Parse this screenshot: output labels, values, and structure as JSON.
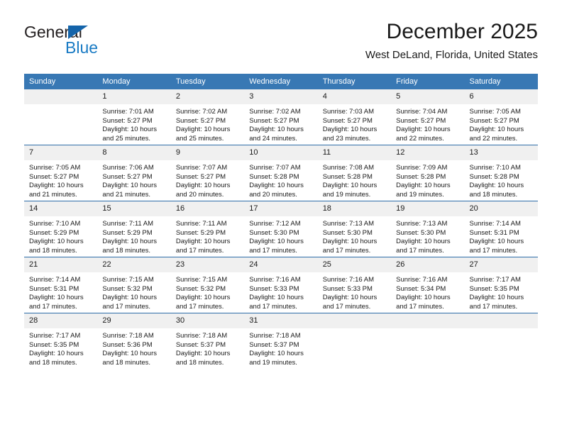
{
  "brand": {
    "name_top": "General",
    "name_bottom": "Blue",
    "accent_color": "#1464aa"
  },
  "header": {
    "title": "December 2025",
    "subtitle": "West DeLand, Florida, United States"
  },
  "theme": {
    "header_row_bg": "#3878b4",
    "daynum_bg": "#f0f0f0",
    "grid_line": "#2d6ca8",
    "text": "#1a1a1a"
  },
  "weekday_headers": [
    "Sunday",
    "Monday",
    "Tuesday",
    "Wednesday",
    "Thursday",
    "Friday",
    "Saturday"
  ],
  "labels": {
    "sunrise_prefix": "Sunrise:",
    "sunset_prefix": "Sunset:",
    "daylight_prefix": "Daylight:"
  },
  "weeks": [
    [
      {
        "day": "",
        "sunrise": "",
        "sunset": "",
        "daylight": "",
        "blank": true
      },
      {
        "day": "1",
        "sunrise": "Sunrise: 7:01 AM",
        "sunset": "Sunset: 5:27 PM",
        "daylight": "Daylight: 10 hours and 25 minutes."
      },
      {
        "day": "2",
        "sunrise": "Sunrise: 7:02 AM",
        "sunset": "Sunset: 5:27 PM",
        "daylight": "Daylight: 10 hours and 25 minutes."
      },
      {
        "day": "3",
        "sunrise": "Sunrise: 7:02 AM",
        "sunset": "Sunset: 5:27 PM",
        "daylight": "Daylight: 10 hours and 24 minutes."
      },
      {
        "day": "4",
        "sunrise": "Sunrise: 7:03 AM",
        "sunset": "Sunset: 5:27 PM",
        "daylight": "Daylight: 10 hours and 23 minutes."
      },
      {
        "day": "5",
        "sunrise": "Sunrise: 7:04 AM",
        "sunset": "Sunset: 5:27 PM",
        "daylight": "Daylight: 10 hours and 22 minutes."
      },
      {
        "day": "6",
        "sunrise": "Sunrise: 7:05 AM",
        "sunset": "Sunset: 5:27 PM",
        "daylight": "Daylight: 10 hours and 22 minutes."
      }
    ],
    [
      {
        "day": "7",
        "sunrise": "Sunrise: 7:05 AM",
        "sunset": "Sunset: 5:27 PM",
        "daylight": "Daylight: 10 hours and 21 minutes."
      },
      {
        "day": "8",
        "sunrise": "Sunrise: 7:06 AM",
        "sunset": "Sunset: 5:27 PM",
        "daylight": "Daylight: 10 hours and 21 minutes."
      },
      {
        "day": "9",
        "sunrise": "Sunrise: 7:07 AM",
        "sunset": "Sunset: 5:27 PM",
        "daylight": "Daylight: 10 hours and 20 minutes."
      },
      {
        "day": "10",
        "sunrise": "Sunrise: 7:07 AM",
        "sunset": "Sunset: 5:28 PM",
        "daylight": "Daylight: 10 hours and 20 minutes."
      },
      {
        "day": "11",
        "sunrise": "Sunrise: 7:08 AM",
        "sunset": "Sunset: 5:28 PM",
        "daylight": "Daylight: 10 hours and 19 minutes."
      },
      {
        "day": "12",
        "sunrise": "Sunrise: 7:09 AM",
        "sunset": "Sunset: 5:28 PM",
        "daylight": "Daylight: 10 hours and 19 minutes."
      },
      {
        "day": "13",
        "sunrise": "Sunrise: 7:10 AM",
        "sunset": "Sunset: 5:28 PM",
        "daylight": "Daylight: 10 hours and 18 minutes."
      }
    ],
    [
      {
        "day": "14",
        "sunrise": "Sunrise: 7:10 AM",
        "sunset": "Sunset: 5:29 PM",
        "daylight": "Daylight: 10 hours and 18 minutes."
      },
      {
        "day": "15",
        "sunrise": "Sunrise: 7:11 AM",
        "sunset": "Sunset: 5:29 PM",
        "daylight": "Daylight: 10 hours and 18 minutes."
      },
      {
        "day": "16",
        "sunrise": "Sunrise: 7:11 AM",
        "sunset": "Sunset: 5:29 PM",
        "daylight": "Daylight: 10 hours and 17 minutes."
      },
      {
        "day": "17",
        "sunrise": "Sunrise: 7:12 AM",
        "sunset": "Sunset: 5:30 PM",
        "daylight": "Daylight: 10 hours and 17 minutes."
      },
      {
        "day": "18",
        "sunrise": "Sunrise: 7:13 AM",
        "sunset": "Sunset: 5:30 PM",
        "daylight": "Daylight: 10 hours and 17 minutes."
      },
      {
        "day": "19",
        "sunrise": "Sunrise: 7:13 AM",
        "sunset": "Sunset: 5:30 PM",
        "daylight": "Daylight: 10 hours and 17 minutes."
      },
      {
        "day": "20",
        "sunrise": "Sunrise: 7:14 AM",
        "sunset": "Sunset: 5:31 PM",
        "daylight": "Daylight: 10 hours and 17 minutes."
      }
    ],
    [
      {
        "day": "21",
        "sunrise": "Sunrise: 7:14 AM",
        "sunset": "Sunset: 5:31 PM",
        "daylight": "Daylight: 10 hours and 17 minutes."
      },
      {
        "day": "22",
        "sunrise": "Sunrise: 7:15 AM",
        "sunset": "Sunset: 5:32 PM",
        "daylight": "Daylight: 10 hours and 17 minutes."
      },
      {
        "day": "23",
        "sunrise": "Sunrise: 7:15 AM",
        "sunset": "Sunset: 5:32 PM",
        "daylight": "Daylight: 10 hours and 17 minutes."
      },
      {
        "day": "24",
        "sunrise": "Sunrise: 7:16 AM",
        "sunset": "Sunset: 5:33 PM",
        "daylight": "Daylight: 10 hours and 17 minutes."
      },
      {
        "day": "25",
        "sunrise": "Sunrise: 7:16 AM",
        "sunset": "Sunset: 5:33 PM",
        "daylight": "Daylight: 10 hours and 17 minutes."
      },
      {
        "day": "26",
        "sunrise": "Sunrise: 7:16 AM",
        "sunset": "Sunset: 5:34 PM",
        "daylight": "Daylight: 10 hours and 17 minutes."
      },
      {
        "day": "27",
        "sunrise": "Sunrise: 7:17 AM",
        "sunset": "Sunset: 5:35 PM",
        "daylight": "Daylight: 10 hours and 17 minutes."
      }
    ],
    [
      {
        "day": "28",
        "sunrise": "Sunrise: 7:17 AM",
        "sunset": "Sunset: 5:35 PM",
        "daylight": "Daylight: 10 hours and 18 minutes."
      },
      {
        "day": "29",
        "sunrise": "Sunrise: 7:18 AM",
        "sunset": "Sunset: 5:36 PM",
        "daylight": "Daylight: 10 hours and 18 minutes."
      },
      {
        "day": "30",
        "sunrise": "Sunrise: 7:18 AM",
        "sunset": "Sunset: 5:37 PM",
        "daylight": "Daylight: 10 hours and 18 minutes."
      },
      {
        "day": "31",
        "sunrise": "Sunrise: 7:18 AM",
        "sunset": "Sunset: 5:37 PM",
        "daylight": "Daylight: 10 hours and 19 minutes."
      },
      {
        "day": "",
        "sunrise": "",
        "sunset": "",
        "daylight": "",
        "blank": true
      },
      {
        "day": "",
        "sunrise": "",
        "sunset": "",
        "daylight": "",
        "blank": true
      },
      {
        "day": "",
        "sunrise": "",
        "sunset": "",
        "daylight": "",
        "blank": true
      }
    ]
  ]
}
